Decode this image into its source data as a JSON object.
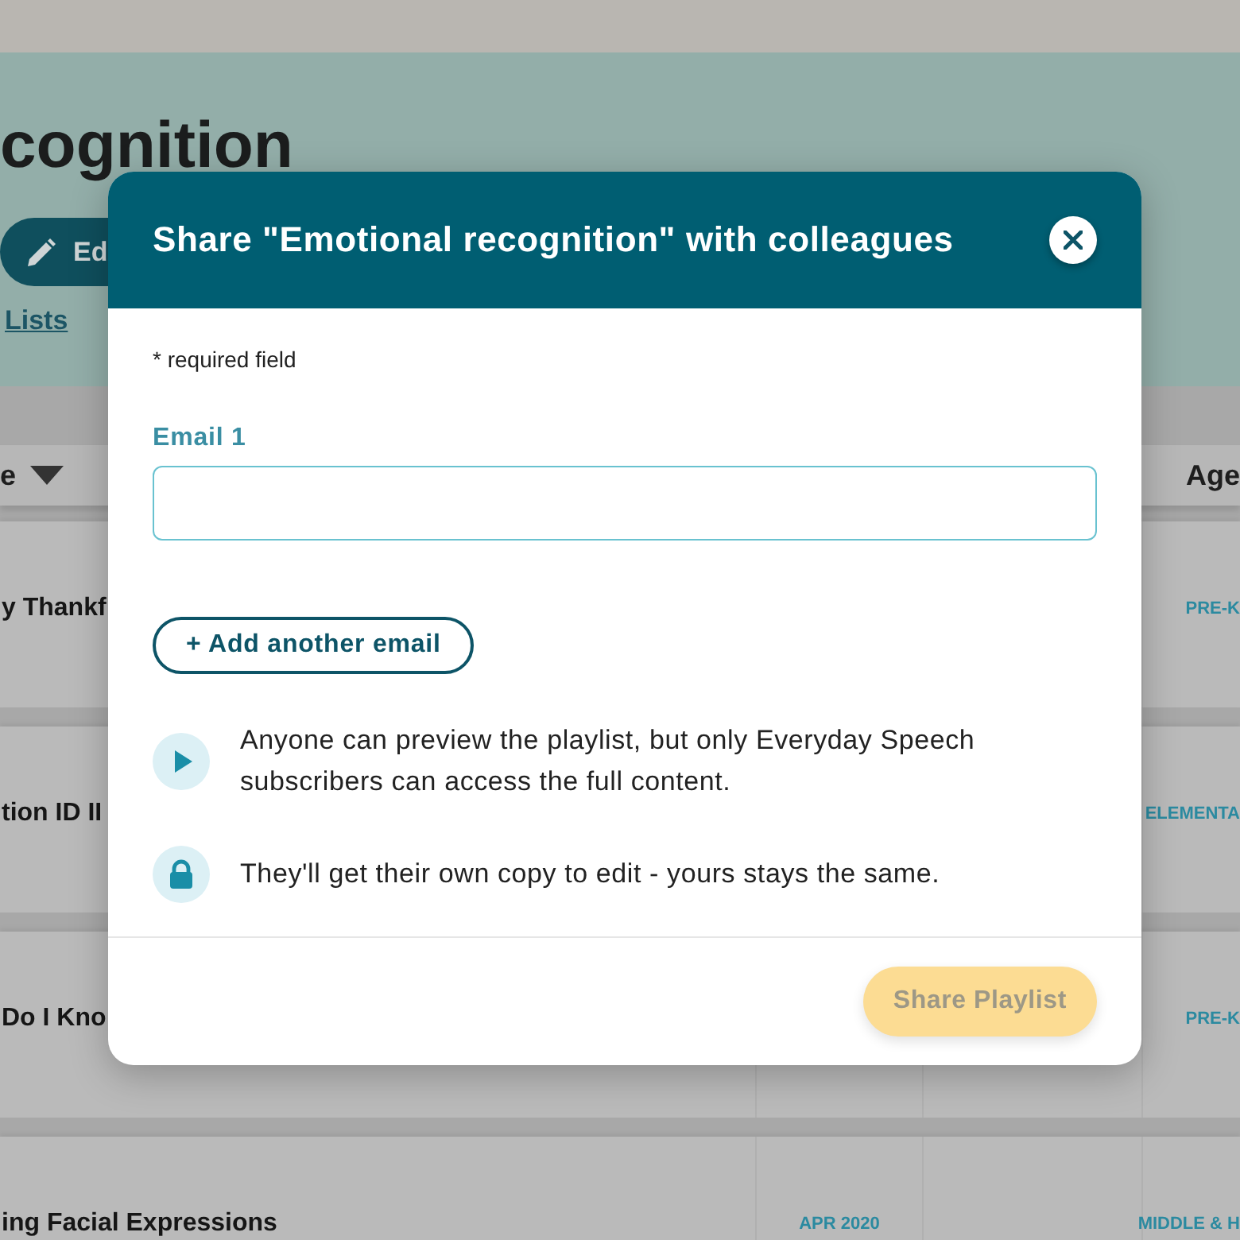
{
  "page": {
    "title": "cognition",
    "edit_button": {
      "label": "Ed"
    },
    "link": "Lists"
  },
  "table": {
    "columns": [
      {
        "label": "e",
        "sorted": true
      },
      {
        "label": "Age",
        "sorted": false
      }
    ],
    "rows": [
      {
        "title": "y Thankf",
        "age": "PRE-K"
      },
      {
        "title": "tion ID II",
        "age": "ELEMENTA"
      },
      {
        "title": "Do I Kno",
        "age": "PRE-K"
      },
      {
        "title": "ing Facial Expressions",
        "date": "APR 2020",
        "age": "MIDDLE & H"
      }
    ]
  },
  "dialog": {
    "title": "Share \"Emotional recognition\" with colleagues",
    "required_note": "* required field",
    "fields": [
      {
        "label": "Email 1"
      }
    ],
    "add_button": "+ Add another email",
    "notes": [
      {
        "kind": "play",
        "text": "Anyone can preview the playlist, but only Everyday Speech subscribers can access the full content."
      },
      {
        "kind": "lock",
        "text": "They'll get their own copy to edit - yours stays the same."
      }
    ],
    "submit": {
      "label": "Share Playlist",
      "disabled": true
    }
  }
}
